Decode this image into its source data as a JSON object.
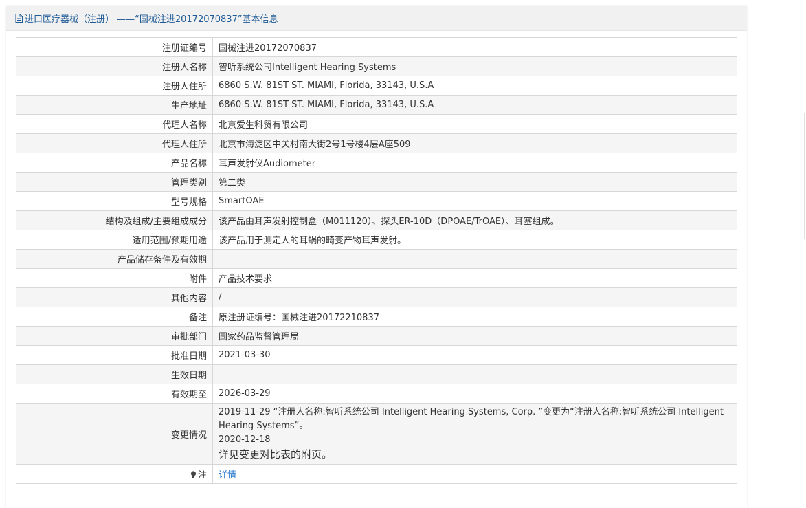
{
  "header": {
    "title": "进口医疗器械（注册） ——“国械注进20172070837”基本信息",
    "icon": "document-icon"
  },
  "rows": [
    {
      "label": "注册证编号",
      "value": "国械注进20172070837"
    },
    {
      "label": "注册人名称",
      "value": "智听系统公司Intelligent Hearing Systems"
    },
    {
      "label": "注册人住所",
      "value": "6860 S.W. 81ST ST. MIAMI, Florida, 33143, U.S.A"
    },
    {
      "label": "生产地址",
      "value": "6860 S.W. 81ST ST. MIAMI, Florida, 33143, U.S.A"
    },
    {
      "label": "代理人名称",
      "value": "北京爱生科贸有限公司"
    },
    {
      "label": "代理人住所",
      "value": "北京市海淀区中关村南大街2号1号楼4层A座509"
    },
    {
      "label": "产品名称",
      "value": "耳声发射仪Audiometer"
    },
    {
      "label": "管理类别",
      "value": "第二类"
    },
    {
      "label": "型号规格",
      "value": "SmartOAE"
    },
    {
      "label": "结构及组成/主要组成成分",
      "value": "该产品由耳声发射控制盒（M011120）、探头ER-10D（DPOAE/TrOAE）、耳塞组成。"
    },
    {
      "label": "适用范围/预期用途",
      "value": "该产品用于测定人的耳蜗的畸变产物耳声发射。"
    },
    {
      "label": "产品储存条件及有效期",
      "value": ""
    },
    {
      "label": "附件",
      "value": "产品技术要求"
    },
    {
      "label": "其他内容",
      "value": "/"
    },
    {
      "label": "备注",
      "value": "原注册证编号：国械注进20172210837"
    },
    {
      "label": "审批部门",
      "value": "国家药品监督管理局"
    },
    {
      "label": "批准日期",
      "value": "2021-03-30"
    },
    {
      "label": "生效日期",
      "value": ""
    },
    {
      "label": "有效期至",
      "value": "2026-03-29"
    }
  ],
  "changes": {
    "label": "变更情况",
    "line1": "2019-11-29 “注册人名称:智听系统公司 Intelligent Hearing Systems, Corp. ”变更为“注册人名称:智听系统公司 Intelligent Hearing Systems”。",
    "line2": "2020-12-18",
    "line3": "详见变更对比表的附页。"
  },
  "note": {
    "label": "注",
    "icon": "lightbulb-icon",
    "link": "详情",
    "link_color": "#2a7ccf"
  },
  "colors": {
    "title": "#1e5a96",
    "header_bg": "#f1f1f1",
    "alt_row_bg": "#f5f5f5",
    "border": "#d7d7d7"
  }
}
